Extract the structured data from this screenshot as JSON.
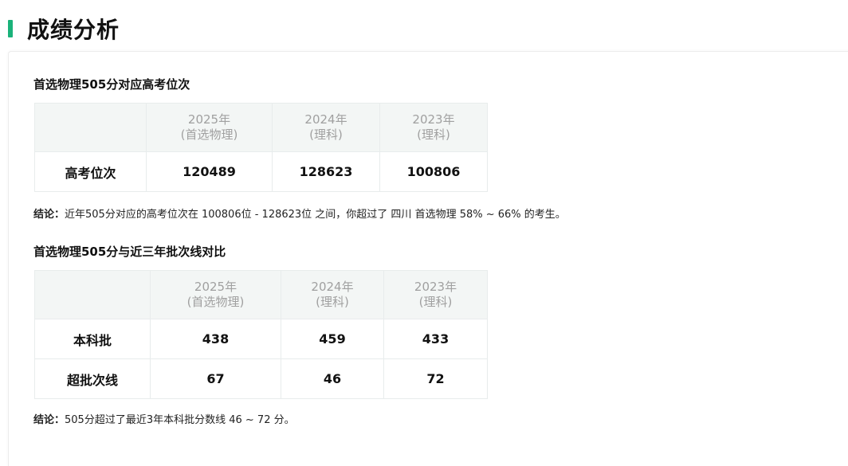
{
  "page_title": "成绩分析",
  "section1": {
    "title": "首选物理505分对应高考位次",
    "headers": [
      {
        "year": "2025年",
        "sub": "(首选物理)"
      },
      {
        "year": "2024年",
        "sub": "(理科)"
      },
      {
        "year": "2023年",
        "sub": "(理科)"
      }
    ],
    "rows": [
      {
        "label": "高考位次",
        "values": [
          "120489",
          "128623",
          "100806"
        ]
      }
    ],
    "conclusion_label": "结论：",
    "conclusion_text": "近年505分对应的高考位次在 100806位 - 128623位 之间，你超过了 四川 首选物理 58% ~ 66% 的考生。"
  },
  "section2": {
    "title": "首选物理505分与近三年批次线对比",
    "headers": [
      {
        "year": "2025年",
        "sub": "(首选物理)"
      },
      {
        "year": "2024年",
        "sub": "(理科)"
      },
      {
        "year": "2023年",
        "sub": "(理科)"
      }
    ],
    "rows": [
      {
        "label": "本科批",
        "values": [
          "438",
          "459",
          "433"
        ]
      },
      {
        "label": "超批次线",
        "values": [
          "67",
          "46",
          "72"
        ]
      }
    ],
    "conclusion_label": "结论：",
    "conclusion_text": "505分超过了最近3年本科批分数线 46 ~ 72 分。"
  },
  "colors": {
    "accent": "#1ab27a",
    "header_bg": "#f3f6f5",
    "header_text": "#a0a0a0"
  }
}
